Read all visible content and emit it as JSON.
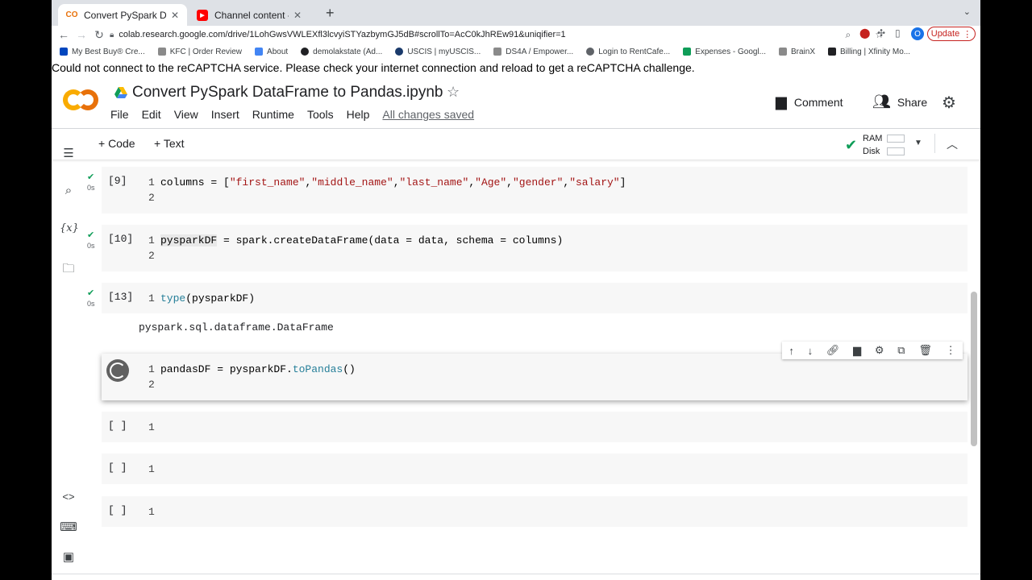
{
  "browser": {
    "tabs": [
      {
        "title": "Convert PySpark DataFrame to",
        "favicon": "colab-icon"
      },
      {
        "title": "Channel content - YouTube Stu",
        "favicon": "youtube-icon"
      }
    ],
    "url": "colab.research.google.com/drive/1LohGwsVWLEXfl3lcvyiSTYazbymGJ5dB#scrollTo=AcC0kJhREw91&uniqifier=1",
    "profile_initial": "O",
    "update_label": "Update"
  },
  "bookmarks": [
    {
      "label": "My Best Buy® Cre...",
      "color": "#0046be"
    },
    {
      "label": "KFC | Order Review",
      "color": "#8a8a8a"
    },
    {
      "label": "About",
      "color": "#4285f4"
    },
    {
      "label": "demolakstate (Ad...",
      "color": "#202124"
    },
    {
      "label": "USCIS | myUSCIS...",
      "color": "#1a3a6b"
    },
    {
      "label": "DS4A / Empower...",
      "color": "#8a8a8a"
    },
    {
      "label": "Login to RentCafe...",
      "color": "#5f6368"
    },
    {
      "label": "Expenses - Googl...",
      "color": "#0f9d58"
    },
    {
      "label": "BrainX",
      "color": "#8a8a8a"
    },
    {
      "label": "Billing | Xfinity Mo...",
      "color": "#202124"
    }
  ],
  "captcha_message": "Could not connect to the reCAPTCHA service. Please check your internet connection and reload to get a reCAPTCHA challenge.",
  "notebook": {
    "title": "Convert PySpark DataFrame to Pandas.ipynb",
    "menu": [
      "File",
      "Edit",
      "View",
      "Insert",
      "Runtime",
      "Tools",
      "Help"
    ],
    "saved_status": "All changes saved",
    "comment_label": "Comment",
    "share_label": "Share"
  },
  "cellbar": {
    "add_code": "+ Code",
    "add_text": "+ Text",
    "ram_label": "RAM",
    "disk_label": "Disk"
  },
  "cells": [
    {
      "exec": "[9]",
      "time": "0s",
      "lines": [
        "1",
        "2"
      ]
    },
    {
      "exec": "[10]",
      "time": "0s",
      "lines": [
        "1",
        "2"
      ]
    },
    {
      "exec": "[13]",
      "time": "0s",
      "lines": [
        "1"
      ],
      "output": "pyspark.sql.dataframe.DataFrame"
    },
    {
      "exec": "",
      "lines": [
        "1",
        "2"
      ]
    },
    {
      "exec": "[ ]",
      "lines": [
        "1"
      ]
    },
    {
      "exec": "[ ]",
      "lines": [
        "1"
      ]
    },
    {
      "exec": "[ ]",
      "lines": [
        "1"
      ]
    }
  ],
  "code": {
    "c1_a": "columns = [",
    "c1_s1": "\"first_name\"",
    "c1_s2": "\"middle_name\"",
    "c1_s3": "\"last_name\"",
    "c1_s4": "\"Age\"",
    "c1_s5": "\"gender\"",
    "c1_s6": "\"salary\"",
    "comma": ",",
    "close": "]",
    "c2_var": "pysparkDF",
    "c2_rest": " = spark.createDataFrame(data = data, schema = columns)",
    "c3_fn": "type",
    "c3_rest": "(pysparkDF)",
    "c4_a": "pandasDF = pysparkDF.",
    "c4_fn": "toPandas",
    "c4_b": "()"
  }
}
